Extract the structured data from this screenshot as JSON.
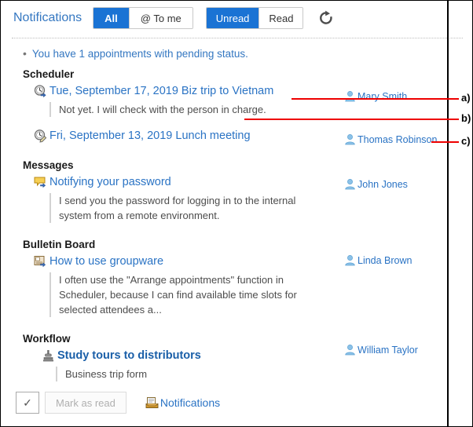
{
  "header": {
    "title": "Notifications",
    "filter_group_1": [
      {
        "label": "All",
        "active": true
      },
      {
        "label": "@ To me",
        "active": false
      }
    ],
    "filter_group_2": [
      {
        "label": "Unread",
        "active": true
      },
      {
        "label": "Read",
        "active": false
      }
    ],
    "refresh_icon": "refresh-icon"
  },
  "notice": {
    "bullet": "•",
    "text": "You have 1 appointments with pending status."
  },
  "sections": [
    {
      "title": "Scheduler",
      "items": [
        {
          "icon": "appointment-clock-arrow-icon",
          "title": "Tue, September 17, 2019 Biz trip to Vietnam",
          "bold": false,
          "body": "Not yet. I will check with the person in charge.",
          "author": "Mary Smith",
          "author_icon": "user-avatar-icon"
        },
        {
          "icon": "appointment-clock-pencil-icon",
          "title": "Fri, September 13, 2019 Lunch meeting",
          "bold": false,
          "body": "",
          "author": "Thomas Robinson",
          "author_icon": "user-avatar-icon"
        }
      ]
    },
    {
      "title": "Messages",
      "items": [
        {
          "icon": "message-balloon-arrow-icon",
          "title": "Notifying your password",
          "bold": false,
          "body": "I send you the password for logging in to the internal system from a remote environment.",
          "author": "John Jones",
          "author_icon": "user-avatar-icon"
        }
      ]
    },
    {
      "title": "Bulletin Board",
      "items": [
        {
          "icon": "bulletin-note-arrow-icon",
          "title": "How to use groupware",
          "bold": false,
          "body": "I often use the \"Arrange appointments\" function in Scheduler, because I can find available time slots for selected attendees a...",
          "author": "Linda Brown",
          "author_icon": "user-avatar-icon"
        }
      ]
    },
    {
      "title": "Workflow",
      "items": [
        {
          "icon": "workflow-stamp-icon",
          "title": "Study tours to distributors",
          "bold": true,
          "body": "Business trip form",
          "author": "William Taylor",
          "author_icon": "user-avatar-icon"
        }
      ]
    }
  ],
  "footer": {
    "check_icon": "checkmark-icon",
    "mark_as_read_label": "Mark as read",
    "notifications_link": "Notifications",
    "notifications_icon": "inbox-tray-icon"
  },
  "annotations": [
    {
      "label": "a)"
    },
    {
      "label": "b)"
    },
    {
      "label": "c)"
    }
  ],
  "colors": {
    "accent_blue": "#1a73d4",
    "link_blue": "#2a73c4",
    "annotation_red": "#ee0000"
  }
}
